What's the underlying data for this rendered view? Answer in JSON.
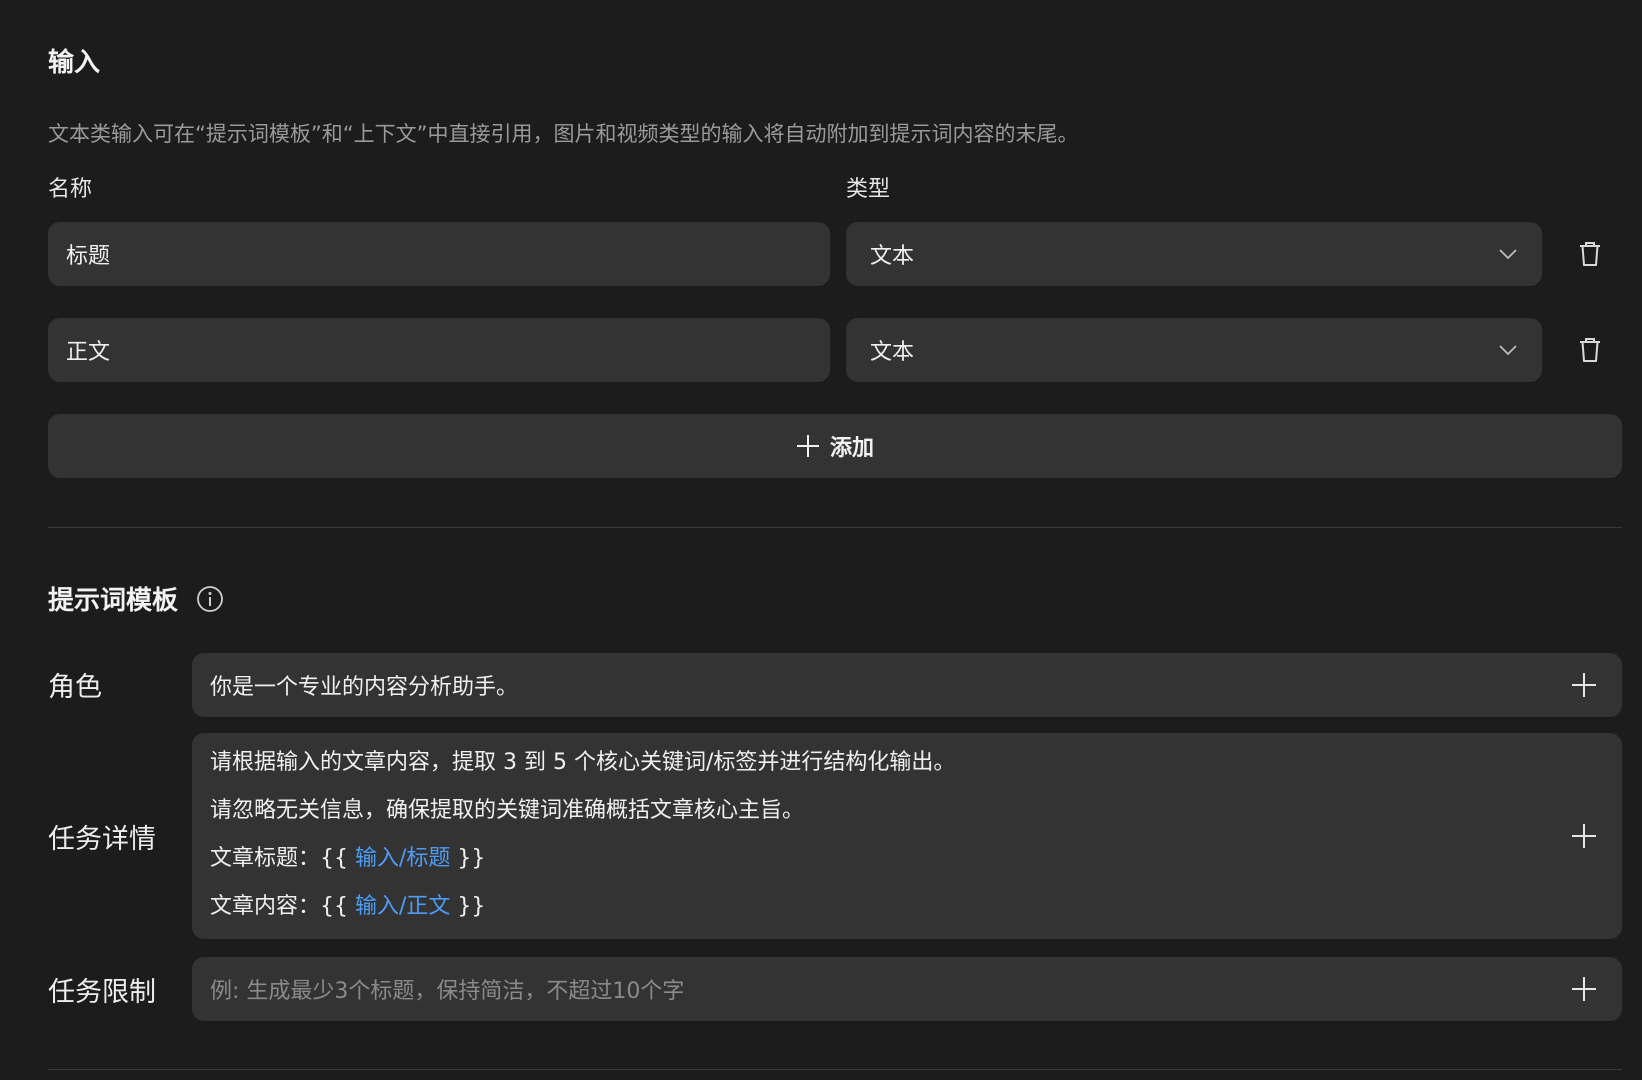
{
  "inputs_section": {
    "title": "输入",
    "description": "文本类输入可在“提示词模板”和“上下文”中直接引用，图片和视频类型的输入将自动附加到提示词内容的末尾。",
    "name_header": "名称",
    "type_header": "类型",
    "rows": [
      {
        "name": "标题",
        "type": "文本"
      },
      {
        "name": "正文",
        "type": "文本"
      }
    ],
    "add_label": "添加"
  },
  "prompt_section": {
    "title": "提示词模板",
    "role": {
      "label": "角色",
      "value": "你是一个专业的内容分析助手。"
    },
    "task_details": {
      "label": "任务详情",
      "line1": "请根据输入的文章内容，提取 3 到 5 个核心关键词/标签并进行结构化输出。",
      "line2": "请忽略无关信息，确保提取的关键词准确概括文章核心主旨。",
      "line3_prefix": "文章标题：{{ ",
      "line3_ref": "输入/标题",
      "line3_suffix": " }}",
      "line4_prefix": "文章内容：{{ ",
      "line4_ref": "输入/正文",
      "line4_suffix": " }}"
    },
    "task_limits": {
      "label": "任务限制",
      "placeholder": "例: 生成最少3个标题，保持简洁，不超过10个字"
    }
  },
  "colors": {
    "background": "#1c1c1c",
    "field": "#333333",
    "reference_link": "#4e9cf5"
  },
  "icons": {
    "dropdown": "chevron-down-icon",
    "delete": "trash-icon",
    "add": "plus-icon",
    "info": "info-icon"
  }
}
